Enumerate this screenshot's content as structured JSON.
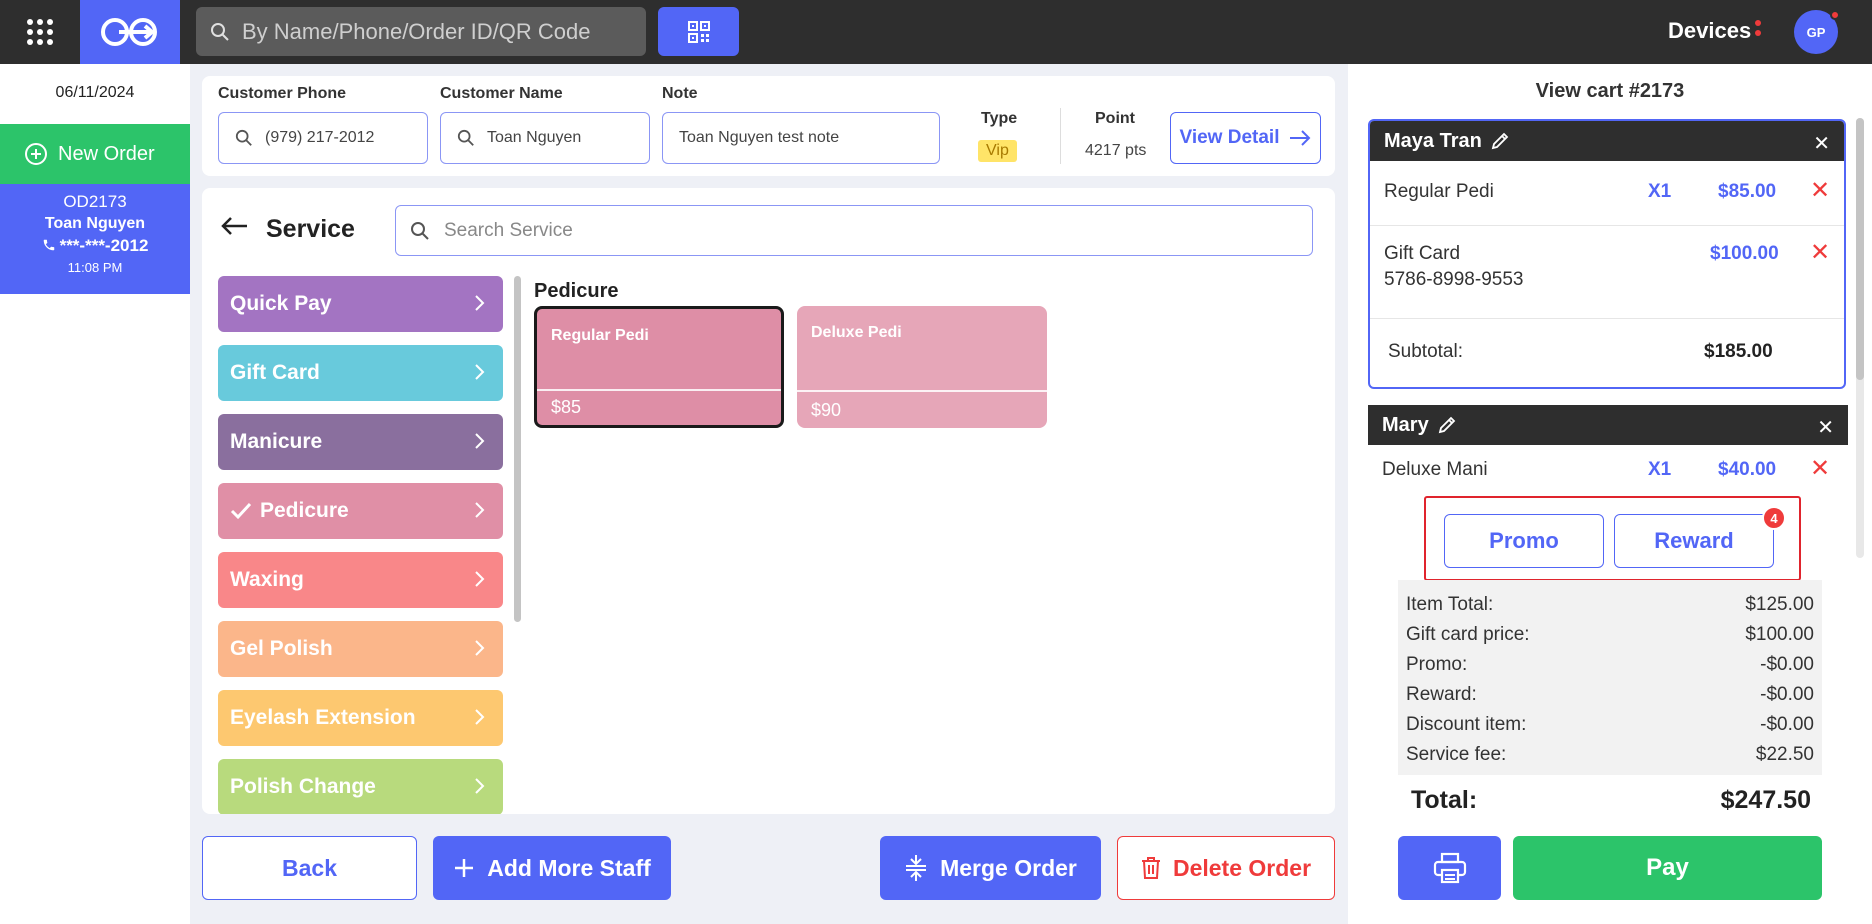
{
  "topbar": {
    "search_placeholder": "By Name/Phone/Order ID/QR Code",
    "devices_label": "Devices",
    "avatar_initials": "GP"
  },
  "sidebar": {
    "date": "06/11/2024",
    "new_order_label": "New Order",
    "order": {
      "id": "OD2173",
      "name": "Toan Nguyen",
      "phone": "***-***-2012",
      "time": "11:08 PM"
    }
  },
  "customer": {
    "phone_label": "Customer Phone",
    "phone_value": "(979) 217-2012",
    "name_label": "Customer Name",
    "name_value": "Toan Nguyen",
    "note_label": "Note",
    "note_value": "Toan Nguyen test note",
    "type_label": "Type",
    "type_value": "Vip",
    "point_label": "Point",
    "point_value": "4217 pts",
    "view_detail_label": "View Detail"
  },
  "service": {
    "title": "Service",
    "search_placeholder": "Search Service",
    "categories": [
      {
        "label": "Quick Pay",
        "color": "#a374c2"
      },
      {
        "label": "Gift Card",
        "color": "#68cadc"
      },
      {
        "label": "Manicure",
        "color": "#8a6f9e"
      },
      {
        "label": "Pedicure",
        "color": "#e08fa6",
        "selected": true
      },
      {
        "label": "Waxing",
        "color": "#f98789"
      },
      {
        "label": "Gel Polish",
        "color": "#fbb68a"
      },
      {
        "label": "Eyelash Extension",
        "color": "#fdc870"
      },
      {
        "label": "Polish Change",
        "color": "#b8da7d"
      }
    ],
    "group_title": "Pedicure",
    "items": [
      {
        "name": "Regular Pedi",
        "price": "$85",
        "color": "#de8ea6"
      },
      {
        "name": "Deluxe Pedi",
        "price": "$90",
        "color": "#e6a6b8"
      }
    ]
  },
  "actions": {
    "back": "Back",
    "add_staff": "Add More Staff",
    "merge": "Merge Order",
    "delete": "Delete Order"
  },
  "cart": {
    "title": "View cart #2173",
    "staff": [
      {
        "name": "Maya Tran",
        "items": [
          {
            "name": "Regular Pedi",
            "qty": "X1",
            "price": "$85.00"
          },
          {
            "name": "Gift Card",
            "sub": "5786-8998-9553",
            "price": "$100.00"
          }
        ],
        "subtotal_label": "Subtotal:",
        "subtotal": "$185.00"
      },
      {
        "name": "Mary",
        "items": [
          {
            "name": "Deluxe Mani",
            "qty": "X1",
            "price": "$40.00"
          }
        ]
      }
    ],
    "promo_label": "Promo",
    "reward_label": "Reward",
    "reward_count": "4",
    "summary": [
      {
        "label": "Item Total:",
        "value": "$125.00"
      },
      {
        "label": "Gift card price:",
        "value": "$100.00"
      },
      {
        "label": "Promo:",
        "value": "-$0.00"
      },
      {
        "label": "Reward:",
        "value": "-$0.00"
      },
      {
        "label": "Discount item:",
        "value": "-$0.00"
      },
      {
        "label": "Service fee:",
        "value": "$22.50"
      }
    ],
    "total_label": "Total:",
    "total_value": "$247.50",
    "pay_label": "Pay"
  }
}
